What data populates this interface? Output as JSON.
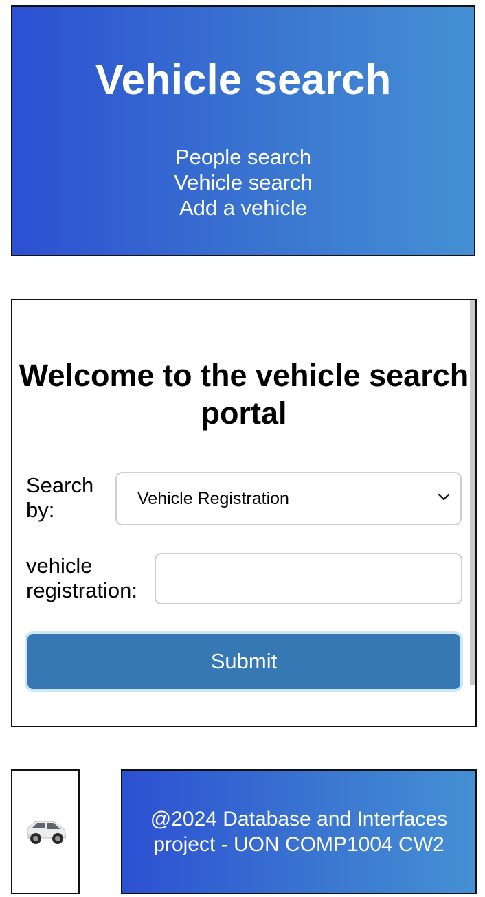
{
  "header": {
    "title": "Vehicle search",
    "nav": [
      "People search",
      "Vehicle search",
      "Add a vehicle"
    ]
  },
  "main": {
    "heading": "Welcome to the vehicle search portal",
    "search_by_label": "Search by:",
    "search_by_selected": "Vehicle Registration",
    "field_label": "vehicle registration:",
    "field_value": "",
    "submit_label": "Submit"
  },
  "footer": {
    "text": "@2024 Database and Interfaces project - UON COMP1004 CW2"
  },
  "colors": {
    "gradient_start": "#2c50d2",
    "gradient_end": "#4590d4",
    "submit_bg": "#3678b3"
  }
}
